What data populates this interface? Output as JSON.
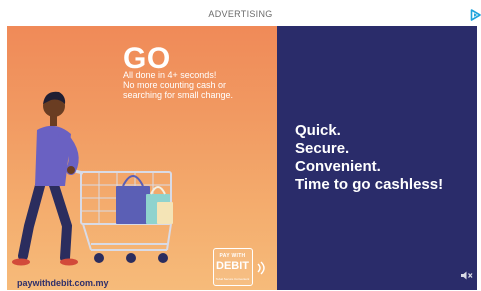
{
  "header": {
    "label": "ADVERTISING",
    "adchoices_icon": "adchoices-triangle-icon"
  },
  "ad": {
    "left_panel": {
      "headline": "GO",
      "subtext": [
        "All done in 4+ seconds!",
        "No more counting cash or",
        "searching for small change."
      ],
      "website": "paywithdebit.com.my",
      "logo": {
        "top_text": "PAY WITH",
        "main_text": "DEBIT",
        "tag_text": "Tebal Secure Convenient"
      }
    },
    "right_panel": {
      "tagline": [
        "Quick.",
        "Secure.",
        "Convenient.",
        "Time to go cashless!"
      ],
      "mute_icon": "speaker-muted-icon"
    },
    "colors": {
      "left_gradient_top": "#f08a58",
      "left_gradient_bottom": "#f6bb7a",
      "right_background": "#2a2c6a",
      "accent_cyan": "#1ea3dc"
    }
  }
}
